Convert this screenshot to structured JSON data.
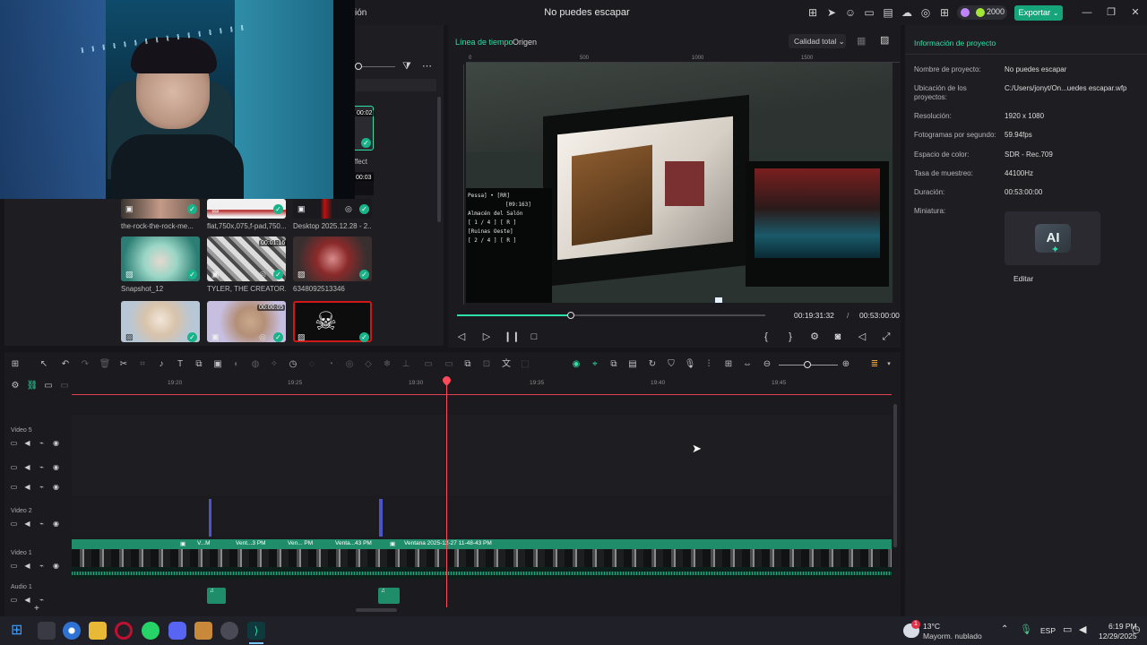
{
  "titlebar": {
    "title": "No puedes escapar",
    "menu_fragment": "ión",
    "credits": "2000",
    "export_label": "Exportar",
    "export_chevron": "⌄"
  },
  "media": {
    "row1": [
      {
        "name": "the-rock-the-rock-me...",
        "duration": ""
      },
      {
        "name": "flat,750x,075,f-pad,750...",
        "duration": ""
      },
      {
        "name": "Desktop 2025.12.28 - 2...",
        "duration": ""
      }
    ],
    "row2": [
      {
        "name": "Snapshot_12",
        "duration": ""
      },
      {
        "name": "TYLER, THE CREATOR.",
        "duration": "00:01:16"
      },
      {
        "name": "6348092513346",
        "duration": ""
      }
    ],
    "row3": [
      {
        "name": "",
        "duration": ""
      },
      {
        "name": "",
        "duration": "00:00:05"
      },
      {
        "name": "",
        "duration": ""
      }
    ],
    "partial_label": "ffect",
    "partial_time_1": "00:02",
    "partial_time_2": "00:03"
  },
  "player": {
    "tab_timeline": "Línea de tiempo",
    "tab_origin": "Origen",
    "quality_label": "Calidad total",
    "quality_chevron": "⌄",
    "ruler": [
      "0",
      "500",
      "1000",
      "1500"
    ],
    "current_time": "00:19:31:32",
    "separator": "/",
    "total_time": "00:53:00:00",
    "progress": 0.37,
    "hud_lines": [
      "Pessa] • [RR]",
      "Almacén del Salón",
      "[ 1 / 4 ] [ R ]",
      "[Ruinas Oeste]",
      "[ 2 / 4 ] [ R ]"
    ],
    "hud_coord": "[09:163]"
  },
  "project_info": {
    "header": "Información de proyecto",
    "rows": [
      {
        "label": "Nombre de proyecto:",
        "value": "No puedes escapar"
      },
      {
        "label": "Ubicación de los proyectos:",
        "value": "C:/Users/jonyt/On...uedes escapar.wfp"
      },
      {
        "label": "Resolución:",
        "value": "1920 x 1080"
      },
      {
        "label": "Fotogramas por segundo:",
        "value": "59.94fps"
      },
      {
        "label": "Espacio de color:",
        "value": "SDR - Rec.709"
      },
      {
        "label": "Tasa de muestreo:",
        "value": "44100Hz"
      },
      {
        "label": "Duración:",
        "value": "00:53:00:00"
      },
      {
        "label": "Miniatura:",
        "value": ""
      }
    ],
    "thumb_text": "AI",
    "edit_label": "Editar"
  },
  "timeline": {
    "ruler": [
      "19:20",
      "19:25",
      "19:30",
      "19:35",
      "19:40",
      "19:45"
    ],
    "tracks": [
      {
        "label": "Video 5"
      },
      {
        "label": ""
      },
      {
        "label": ""
      },
      {
        "label": "Video 2"
      },
      {
        "label": "Video 1"
      },
      {
        "label": "Audio 1"
      }
    ],
    "clips": [
      "V...M",
      "Vent...3 PM",
      "Ven... PM",
      "Venta...43 PM",
      "Ventana 2025-12-27 11-48-43 PM"
    ],
    "add_track": "+"
  },
  "taskbar": {
    "temp": "13°C",
    "weather": "Mayorm. nublado",
    "weather_badge": "1",
    "lang": "ESP",
    "time": "6:19 PM",
    "date": "12/29/2025",
    "up_arrow": "⌃"
  },
  "colors": {
    "accent": "#19b38a",
    "playhead": "#ff4a5a",
    "clip": "#1f8d6a",
    "marker": "#4a56c8",
    "export": "#16a57a"
  }
}
